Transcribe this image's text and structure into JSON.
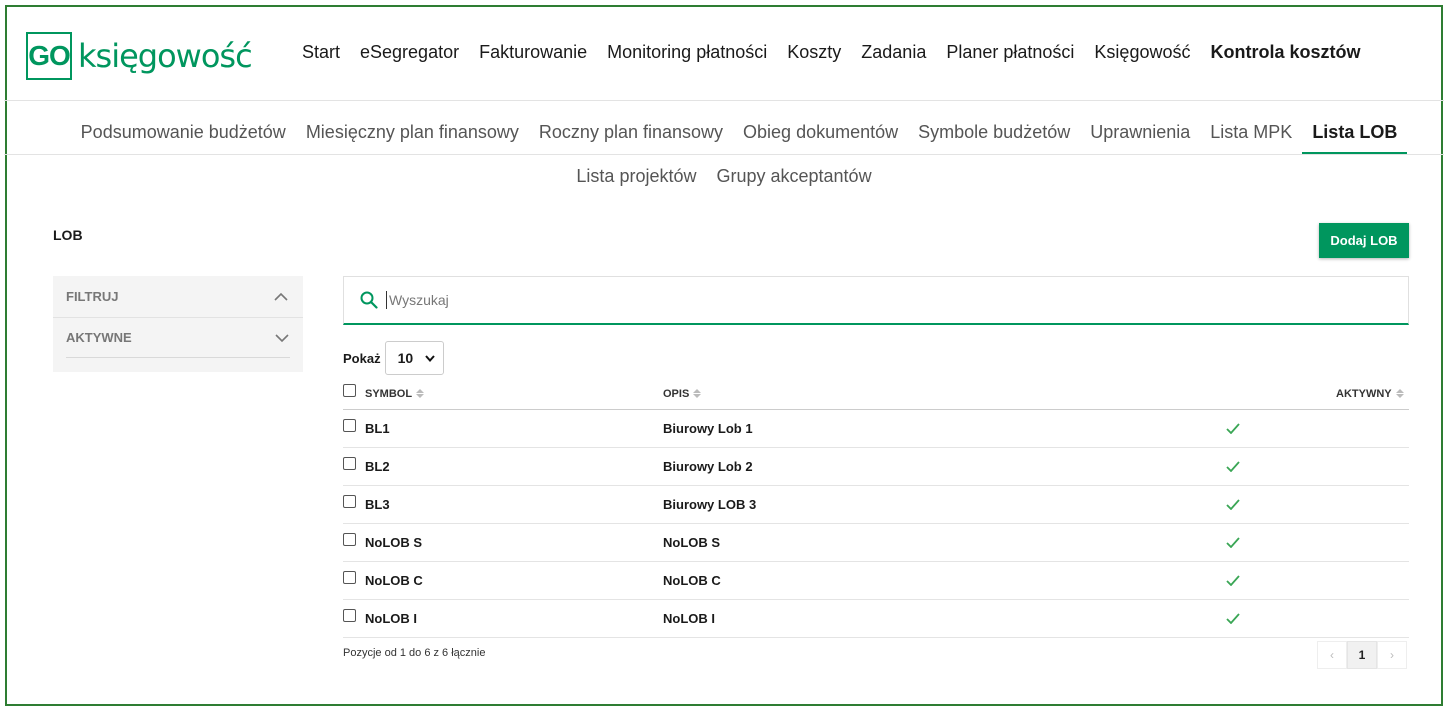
{
  "logo": {
    "box": "GO",
    "text": "księgowość"
  },
  "main_nav": [
    "Start",
    "eSegregator",
    "Fakturowanie",
    "Monitoring płatności",
    "Koszty",
    "Zadania",
    "Planer płatności",
    "Księgowość",
    "Kontrola kosztów"
  ],
  "main_nav_active": 8,
  "sub_nav": [
    "Podsumowanie budżetów",
    "Miesięczny plan finansowy",
    "Roczny plan finansowy",
    "Obieg dokumentów",
    "Symbole budżetów",
    "Uprawnienia",
    "Lista MPK",
    "Lista LOB"
  ],
  "sub_nav_active": 7,
  "sub_nav2": [
    "Lista projektów",
    "Grupy akceptantów"
  ],
  "page_title": "LOB",
  "add_button": "Dodaj LOB",
  "filters": {
    "title": "FILTRUJ",
    "active": "AKTYWNE"
  },
  "search": {
    "placeholder": "Wyszukaj",
    "value": ""
  },
  "show": {
    "label": "Pokaż",
    "value": "10"
  },
  "table": {
    "headers": {
      "symbol": "SYMBOL",
      "opis": "OPIS",
      "aktywny": "AKTYWNY"
    },
    "rows": [
      {
        "symbol": "BL1",
        "opis": "Biurowy Lob 1",
        "aktywny": "✓"
      },
      {
        "symbol": "BL2",
        "opis": "Biurowy Lob 2",
        "aktywny": "✓"
      },
      {
        "symbol": "BL3",
        "opis": "Biurowy LOB 3",
        "aktywny": "✓"
      },
      {
        "symbol": "NoLOB S",
        "opis": "NoLOB S",
        "aktywny": "✓"
      },
      {
        "symbol": "NoLOB C",
        "opis": "NoLOB C",
        "aktywny": "✓"
      },
      {
        "symbol": "NoLOB I",
        "opis": "NoLOB I",
        "aktywny": "✓"
      }
    ]
  },
  "footer": {
    "info": "Pozycje od 1 do 6 z 6 łącznie",
    "page": "1",
    "prev": "‹",
    "next": "›"
  },
  "colors": {
    "accent": "#00965e",
    "check": "#3aa655"
  }
}
